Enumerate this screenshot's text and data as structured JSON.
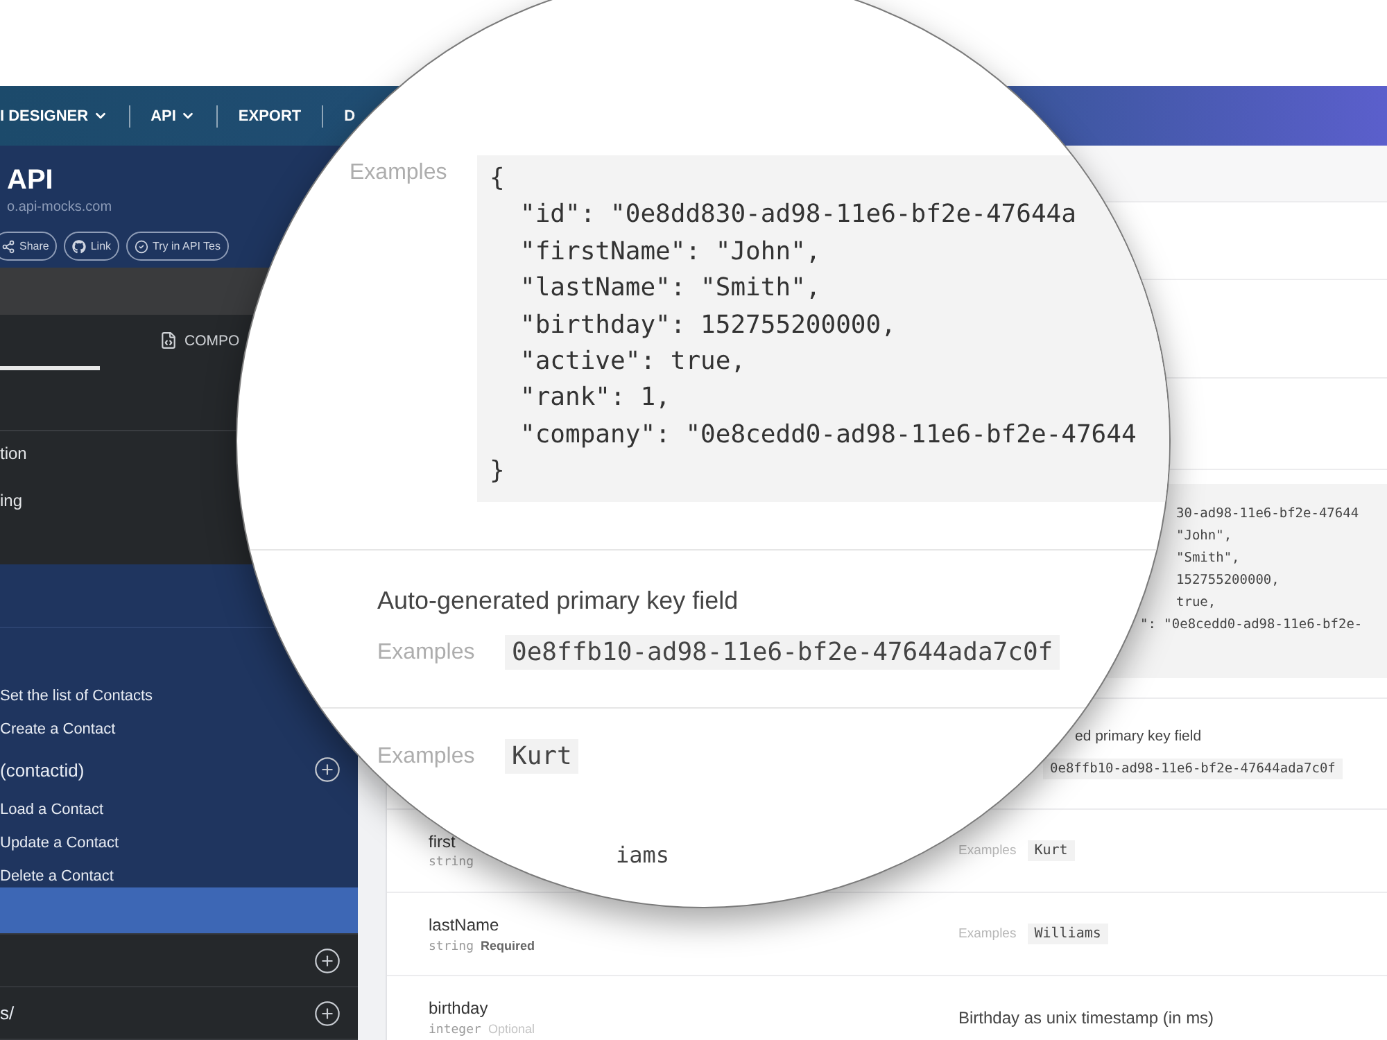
{
  "top_nav": {
    "items": [
      {
        "label": "I DESIGNER",
        "dropdown": true
      },
      {
        "label": "API",
        "dropdown": true
      },
      {
        "label": "EXPORT",
        "dropdown": false
      },
      {
        "label": "D",
        "dropdown": false
      }
    ]
  },
  "sidebar": {
    "project": {
      "title": "API",
      "url": "o.api-mocks.com",
      "buttons": [
        {
          "label": "Share",
          "kind": "share"
        },
        {
          "label": "Link",
          "kind": "link"
        },
        {
          "label": "Try in API Tes",
          "kind": "try"
        }
      ]
    },
    "tabs": [
      {
        "selected": true
      },
      {
        "label": "COMPO",
        "selected": false
      }
    ],
    "pages": [
      {
        "label": "tion"
      },
      {
        "label": "ing"
      }
    ],
    "operations": [
      {
        "kind": "operation",
        "label": "Set the list of Contacts"
      },
      {
        "kind": "operation",
        "label": "Create a Contact"
      },
      {
        "kind": "resource",
        "label": "(contactid)"
      },
      {
        "kind": "operation",
        "label": "Load a Contact"
      },
      {
        "kind": "operation",
        "label": "Update a Contact"
      },
      {
        "kind": "operation",
        "label": "Delete a Contact"
      }
    ],
    "resource_rows": [
      {
        "selected": true,
        "add_button": false
      },
      {
        "selected": false,
        "add_button": true
      },
      {
        "selected": false,
        "add_button": true,
        "label": "s/"
      }
    ]
  },
  "content": {
    "code_fragment": [
      "30-ad98-11e6-bf2e-47644",
      "\"John\",",
      "\"Smith\",",
      "152755200000,",
      "true,",
      "\": \"0e8cedd0-ad98-11e6-bf2e-"
    ],
    "id_field": {
      "description": "ed primary key field",
      "example": "0e8ffb10-ad98-11e6-bf2e-47644ada7c0f"
    },
    "fields": [
      {
        "name": "first",
        "type": "string",
        "example_label": "Examples",
        "example": "Kurt"
      },
      {
        "name": "lastName",
        "type": "string",
        "requirement": "Required",
        "required": true,
        "example_label": "Examples",
        "example": "Williams"
      },
      {
        "name": "birthday",
        "type": "integer",
        "requirement": "Optional",
        "required": false,
        "description": "Birthday as unix timestamp (in ms)"
      }
    ]
  },
  "magnifier": {
    "example_label": "Examples",
    "code": [
      "{",
      "\"id\": \"0e8dd830-ad98-11e6-bf2e-47644a",
      "\"firstName\": \"John\",",
      "\"lastName\": \"Smith\",",
      "\"birthday\": 152755200000,",
      "\"active\": true,",
      "\"rank\": 1,",
      "\"company\": \"0e8cedd0-ad98-11e6-bf2e-47644",
      "}"
    ],
    "description": "Auto-generated primary key field",
    "id_example_label": "Examples",
    "id_example": "0e8ffb10-ad98-11e6-bf2e-47644ada7c0f",
    "name_example_label": "Examples",
    "name_example": "Kurt",
    "cut_example": "iams"
  }
}
